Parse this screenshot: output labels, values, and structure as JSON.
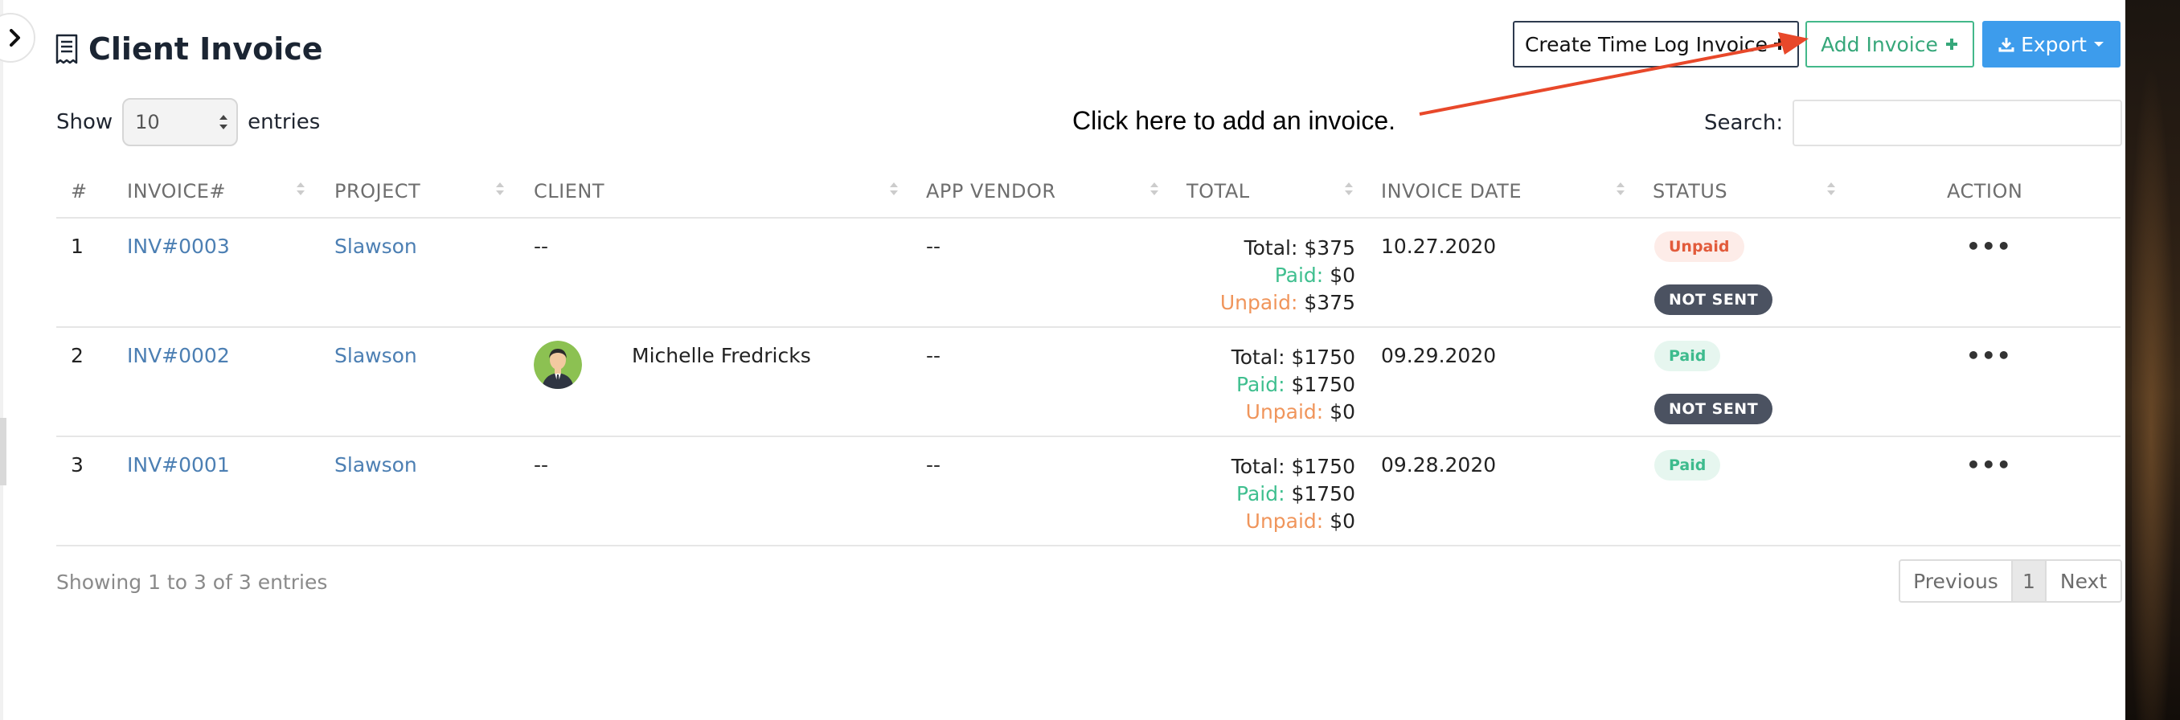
{
  "header": {
    "title": "Client Invoice",
    "btn_timelog": "Create Time Log Invoice",
    "btn_add": "Add Invoice",
    "btn_export": "Export"
  },
  "controls": {
    "show_label": "Show",
    "entries_label": "entries",
    "page_length": "10",
    "search_label": "Search:",
    "search_value": ""
  },
  "annotation": "Click here to add an invoice.",
  "table": {
    "columns": [
      "#",
      "INVOICE#",
      "PROJECT",
      "CLIENT",
      "APP VENDOR",
      "TOTAL",
      "INVOICE DATE",
      "STATUS",
      "ACTION"
    ],
    "rows": [
      {
        "num": "1",
        "invoice": "INV#0003",
        "project": "Slawson",
        "client": "--",
        "vendor": "--",
        "total_label": "Total: ",
        "total": "$375",
        "paid_label": "Paid: ",
        "paid": "$0",
        "unpaid_label": "Unpaid: ",
        "unpaid": "$375",
        "date": "10.27.2020",
        "status": "Unpaid",
        "sent": "NOT SENT",
        "action": "•••"
      },
      {
        "num": "2",
        "invoice": "INV#0002",
        "project": "Slawson",
        "client": "Michelle Fredricks",
        "vendor": "--",
        "total_label": "Total: ",
        "total": "$1750",
        "paid_label": "Paid: ",
        "paid": "$1750",
        "unpaid_label": "Unpaid: ",
        "unpaid": "$0",
        "date": "09.29.2020",
        "status": "Paid",
        "sent": "NOT SENT",
        "action": "•••"
      },
      {
        "num": "3",
        "invoice": "INV#0001",
        "project": "Slawson",
        "client": "--",
        "vendor": "--",
        "total_label": "Total: ",
        "total": "$1750",
        "paid_label": "Paid: ",
        "paid": "$1750",
        "unpaid_label": "Unpaid: ",
        "unpaid": "$0",
        "date": "09.28.2020",
        "status": "Paid",
        "action": "•••"
      }
    ]
  },
  "footer": {
    "info": "Showing 1 to 3 of 3 entries",
    "prev": "Previous",
    "page": "1",
    "next": "Next"
  },
  "colors": {
    "accent_green": "#43b88a",
    "accent_blue": "#3d9cec",
    "link": "#4c7fb3",
    "arrow": "#e8482a"
  }
}
